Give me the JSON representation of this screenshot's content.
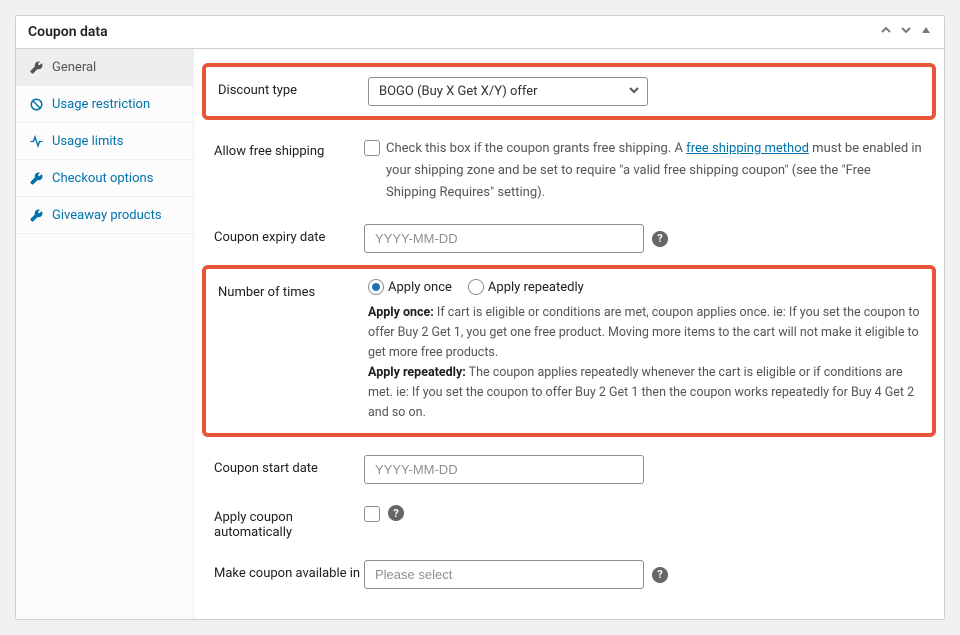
{
  "panel": {
    "title": "Coupon data"
  },
  "sidebar": {
    "items": [
      {
        "label": "General"
      },
      {
        "label": "Usage restriction"
      },
      {
        "label": "Usage limits"
      },
      {
        "label": "Checkout options"
      },
      {
        "label": "Giveaway products"
      }
    ]
  },
  "fields": {
    "discount_type": {
      "label": "Discount type",
      "value": "BOGO (Buy X Get X/Y) offer"
    },
    "free_shipping": {
      "label": "Allow free shipping",
      "help_prefix": "Check this box if the coupon grants free shipping. A ",
      "help_link": "free shipping method",
      "help_suffix": " must be enabled in your shipping zone and be set to require \"a valid free shipping coupon\" (see the \"Free Shipping Requires\" setting)."
    },
    "expiry": {
      "label": "Coupon expiry date",
      "placeholder": "YYYY-MM-DD"
    },
    "num_times": {
      "label": "Number of times",
      "opt_once": "Apply once",
      "opt_repeat": "Apply repeatedly",
      "once_label": "Apply once:",
      "once_text": " If cart is eligible or conditions are met, coupon applies once. ie: If you set the coupon to offer Buy 2 Get 1, you get one free product. Moving more items to the cart will not make it eligible to get more free products.",
      "repeat_label": "Apply repeatedly:",
      "repeat_text": " The coupon applies repeatedly whenever the cart is eligible or if conditions are met. ie: If you set the coupon to offer Buy 2 Get 1 then the coupon works repeatedly for Buy 4 Get 2 and so on."
    },
    "start": {
      "label": "Coupon start date",
      "placeholder": "YYYY-MM-DD"
    },
    "auto": {
      "label": "Apply coupon automatically"
    },
    "available": {
      "label": "Make coupon available in",
      "placeholder": "Please select"
    }
  }
}
